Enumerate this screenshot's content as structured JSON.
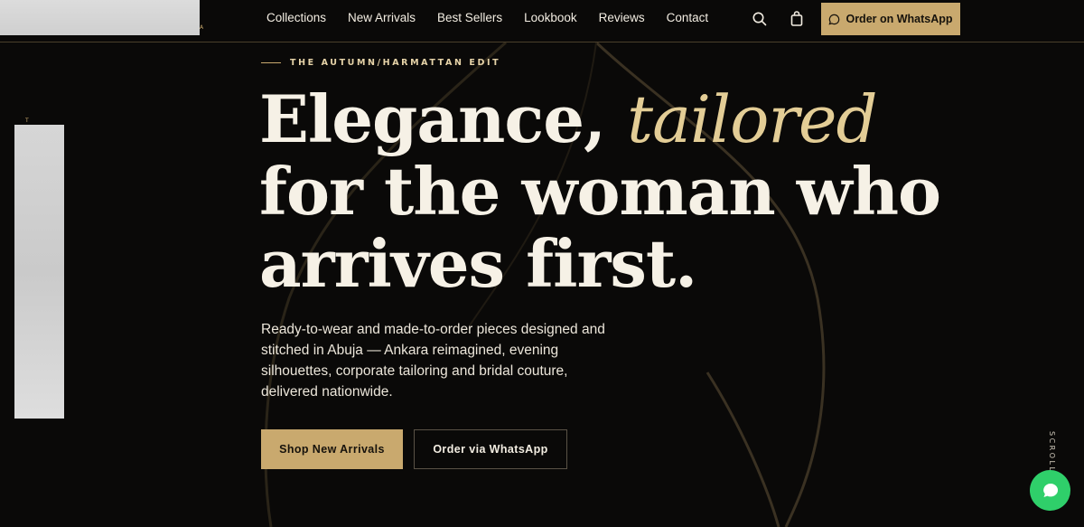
{
  "header": {
    "logo_mark": "A",
    "nav": [
      "Collections",
      "New Arrivals",
      "Best Sellers",
      "Lookbook",
      "Reviews",
      "Contact"
    ],
    "search_icon": "search-icon",
    "bag_icon": "shopping-bag-icon",
    "whatsapp_button": "Order on WhatsApp"
  },
  "hero": {
    "eyebrow": "THE AUTUMN/HARMATTAN EDIT",
    "headline_line1_start": "Elegance, ",
    "headline_line1_accent": "tailored",
    "headline_line2": "for the woman who",
    "headline_line3": "arrives first.",
    "description": "Ready-to-wear and made-to-order pieces designed and stitched in Abuja — Ankara reimagined, evening silhouettes, corporate tailoring and bridal couture, delivered nationwide.",
    "primary_button": "Shop New Arrivals",
    "secondary_button": "Order via WhatsApp"
  },
  "side_mark": "T",
  "scroll_label": "SCROLL",
  "colors": {
    "background": "#0a0908",
    "accent_gold": "#c9a96e",
    "headline_accent": "#e3cd96",
    "whatsapp_green": "#2fcf6a"
  }
}
